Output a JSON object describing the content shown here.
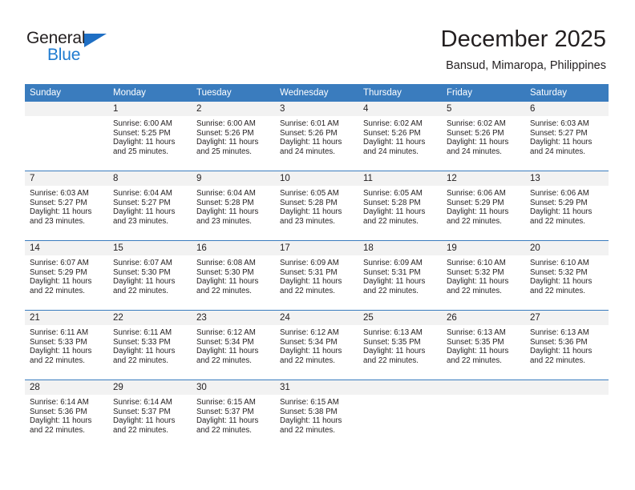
{
  "brand": {
    "name_primary": "General",
    "name_secondary": "Blue",
    "triangle_icon": "triangle-icon",
    "accent_color": "#1f7bd0"
  },
  "header": {
    "title": "December 2025",
    "subtitle": "Bansud, Mimaropa, Philippines"
  },
  "theme": {
    "header_bg": "#3a7cbe",
    "header_text": "#ffffff",
    "daynum_bg": "#f2f2f2",
    "cell_bg": "#ffffff",
    "text": "#231f20",
    "row_divider": "#3a7cbe"
  },
  "calendar": {
    "columns": [
      "Sunday",
      "Monday",
      "Tuesday",
      "Wednesday",
      "Thursday",
      "Friday",
      "Saturday"
    ],
    "weeks": [
      [
        {
          "day": "",
          "blank": true,
          "sunrise": "",
          "sunset": "",
          "daylight_1": "",
          "daylight_2": ""
        },
        {
          "day": "1",
          "sunrise": "Sunrise: 6:00 AM",
          "sunset": "Sunset: 5:25 PM",
          "daylight_1": "Daylight: 11 hours",
          "daylight_2": "and 25 minutes."
        },
        {
          "day": "2",
          "sunrise": "Sunrise: 6:00 AM",
          "sunset": "Sunset: 5:26 PM",
          "daylight_1": "Daylight: 11 hours",
          "daylight_2": "and 25 minutes."
        },
        {
          "day": "3",
          "sunrise": "Sunrise: 6:01 AM",
          "sunset": "Sunset: 5:26 PM",
          "daylight_1": "Daylight: 11 hours",
          "daylight_2": "and 24 minutes."
        },
        {
          "day": "4",
          "sunrise": "Sunrise: 6:02 AM",
          "sunset": "Sunset: 5:26 PM",
          "daylight_1": "Daylight: 11 hours",
          "daylight_2": "and 24 minutes."
        },
        {
          "day": "5",
          "sunrise": "Sunrise: 6:02 AM",
          "sunset": "Sunset: 5:26 PM",
          "daylight_1": "Daylight: 11 hours",
          "daylight_2": "and 24 minutes."
        },
        {
          "day": "6",
          "sunrise": "Sunrise: 6:03 AM",
          "sunset": "Sunset: 5:27 PM",
          "daylight_1": "Daylight: 11 hours",
          "daylight_2": "and 24 minutes."
        }
      ],
      [
        {
          "day": "7",
          "sunrise": "Sunrise: 6:03 AM",
          "sunset": "Sunset: 5:27 PM",
          "daylight_1": "Daylight: 11 hours",
          "daylight_2": "and 23 minutes."
        },
        {
          "day": "8",
          "sunrise": "Sunrise: 6:04 AM",
          "sunset": "Sunset: 5:27 PM",
          "daylight_1": "Daylight: 11 hours",
          "daylight_2": "and 23 minutes."
        },
        {
          "day": "9",
          "sunrise": "Sunrise: 6:04 AM",
          "sunset": "Sunset: 5:28 PM",
          "daylight_1": "Daylight: 11 hours",
          "daylight_2": "and 23 minutes."
        },
        {
          "day": "10",
          "sunrise": "Sunrise: 6:05 AM",
          "sunset": "Sunset: 5:28 PM",
          "daylight_1": "Daylight: 11 hours",
          "daylight_2": "and 23 minutes."
        },
        {
          "day": "11",
          "sunrise": "Sunrise: 6:05 AM",
          "sunset": "Sunset: 5:28 PM",
          "daylight_1": "Daylight: 11 hours",
          "daylight_2": "and 22 minutes."
        },
        {
          "day": "12",
          "sunrise": "Sunrise: 6:06 AM",
          "sunset": "Sunset: 5:29 PM",
          "daylight_1": "Daylight: 11 hours",
          "daylight_2": "and 22 minutes."
        },
        {
          "day": "13",
          "sunrise": "Sunrise: 6:06 AM",
          "sunset": "Sunset: 5:29 PM",
          "daylight_1": "Daylight: 11 hours",
          "daylight_2": "and 22 minutes."
        }
      ],
      [
        {
          "day": "14",
          "sunrise": "Sunrise: 6:07 AM",
          "sunset": "Sunset: 5:29 PM",
          "daylight_1": "Daylight: 11 hours",
          "daylight_2": "and 22 minutes."
        },
        {
          "day": "15",
          "sunrise": "Sunrise: 6:07 AM",
          "sunset": "Sunset: 5:30 PM",
          "daylight_1": "Daylight: 11 hours",
          "daylight_2": "and 22 minutes."
        },
        {
          "day": "16",
          "sunrise": "Sunrise: 6:08 AM",
          "sunset": "Sunset: 5:30 PM",
          "daylight_1": "Daylight: 11 hours",
          "daylight_2": "and 22 minutes."
        },
        {
          "day": "17",
          "sunrise": "Sunrise: 6:09 AM",
          "sunset": "Sunset: 5:31 PM",
          "daylight_1": "Daylight: 11 hours",
          "daylight_2": "and 22 minutes."
        },
        {
          "day": "18",
          "sunrise": "Sunrise: 6:09 AM",
          "sunset": "Sunset: 5:31 PM",
          "daylight_1": "Daylight: 11 hours",
          "daylight_2": "and 22 minutes."
        },
        {
          "day": "19",
          "sunrise": "Sunrise: 6:10 AM",
          "sunset": "Sunset: 5:32 PM",
          "daylight_1": "Daylight: 11 hours",
          "daylight_2": "and 22 minutes."
        },
        {
          "day": "20",
          "sunrise": "Sunrise: 6:10 AM",
          "sunset": "Sunset: 5:32 PM",
          "daylight_1": "Daylight: 11 hours",
          "daylight_2": "and 22 minutes."
        }
      ],
      [
        {
          "day": "21",
          "sunrise": "Sunrise: 6:11 AM",
          "sunset": "Sunset: 5:33 PM",
          "daylight_1": "Daylight: 11 hours",
          "daylight_2": "and 22 minutes."
        },
        {
          "day": "22",
          "sunrise": "Sunrise: 6:11 AM",
          "sunset": "Sunset: 5:33 PM",
          "daylight_1": "Daylight: 11 hours",
          "daylight_2": "and 22 minutes."
        },
        {
          "day": "23",
          "sunrise": "Sunrise: 6:12 AM",
          "sunset": "Sunset: 5:34 PM",
          "daylight_1": "Daylight: 11 hours",
          "daylight_2": "and 22 minutes."
        },
        {
          "day": "24",
          "sunrise": "Sunrise: 6:12 AM",
          "sunset": "Sunset: 5:34 PM",
          "daylight_1": "Daylight: 11 hours",
          "daylight_2": "and 22 minutes."
        },
        {
          "day": "25",
          "sunrise": "Sunrise: 6:13 AM",
          "sunset": "Sunset: 5:35 PM",
          "daylight_1": "Daylight: 11 hours",
          "daylight_2": "and 22 minutes."
        },
        {
          "day": "26",
          "sunrise": "Sunrise: 6:13 AM",
          "sunset": "Sunset: 5:35 PM",
          "daylight_1": "Daylight: 11 hours",
          "daylight_2": "and 22 minutes."
        },
        {
          "day": "27",
          "sunrise": "Sunrise: 6:13 AM",
          "sunset": "Sunset: 5:36 PM",
          "daylight_1": "Daylight: 11 hours",
          "daylight_2": "and 22 minutes."
        }
      ],
      [
        {
          "day": "28",
          "sunrise": "Sunrise: 6:14 AM",
          "sunset": "Sunset: 5:36 PM",
          "daylight_1": "Daylight: 11 hours",
          "daylight_2": "and 22 minutes."
        },
        {
          "day": "29",
          "sunrise": "Sunrise: 6:14 AM",
          "sunset": "Sunset: 5:37 PM",
          "daylight_1": "Daylight: 11 hours",
          "daylight_2": "and 22 minutes."
        },
        {
          "day": "30",
          "sunrise": "Sunrise: 6:15 AM",
          "sunset": "Sunset: 5:37 PM",
          "daylight_1": "Daylight: 11 hours",
          "daylight_2": "and 22 minutes."
        },
        {
          "day": "31",
          "sunrise": "Sunrise: 6:15 AM",
          "sunset": "Sunset: 5:38 PM",
          "daylight_1": "Daylight: 11 hours",
          "daylight_2": "and 22 minutes."
        },
        {
          "day": "",
          "blank": true,
          "sunrise": "",
          "sunset": "",
          "daylight_1": "",
          "daylight_2": ""
        },
        {
          "day": "",
          "blank": true,
          "sunrise": "",
          "sunset": "",
          "daylight_1": "",
          "daylight_2": ""
        },
        {
          "day": "",
          "blank": true,
          "sunrise": "",
          "sunset": "",
          "daylight_1": "",
          "daylight_2": ""
        }
      ]
    ]
  }
}
